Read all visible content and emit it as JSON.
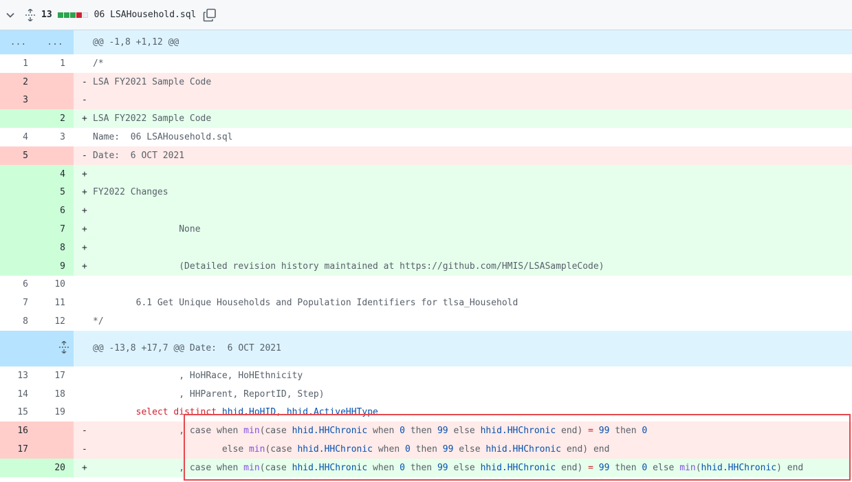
{
  "file_header": {
    "changes_count": "13",
    "filename": "06 LSAHousehold.sql",
    "diffstat": [
      "add",
      "add",
      "add",
      "del",
      "neutral"
    ]
  },
  "hunk1": {
    "old": "...",
    "new": "...",
    "text": "@@ -1,8 +1,12 @@"
  },
  "hunk2": {
    "text": "@@ -13,8 +17,7 @@ Date:  6 OCT 2021"
  },
  "lines1": [
    {
      "type": "ctx",
      "old": "1",
      "new": "1",
      "sign": " ",
      "code": "/*"
    },
    {
      "type": "del",
      "old": "2",
      "new": "",
      "sign": "-",
      "code": "LSA FY2021 Sample Code"
    },
    {
      "type": "del",
      "old": "3",
      "new": "",
      "sign": "-",
      "code": ""
    },
    {
      "type": "add",
      "old": "",
      "new": "2",
      "sign": "+",
      "code": "LSA FY2022 Sample Code"
    },
    {
      "type": "ctx",
      "old": "4",
      "new": "3",
      "sign": " ",
      "code": "Name:  06 LSAHousehold.sql"
    },
    {
      "type": "del",
      "old": "5",
      "new": "",
      "sign": "-",
      "code": "Date:  6 OCT 2021"
    },
    {
      "type": "add",
      "old": "",
      "new": "4",
      "sign": "+",
      "code": ""
    },
    {
      "type": "add",
      "old": "",
      "new": "5",
      "sign": "+",
      "code": "FY2022 Changes"
    },
    {
      "type": "add",
      "old": "",
      "new": "6",
      "sign": "+",
      "code": ""
    },
    {
      "type": "add",
      "old": "",
      "new": "7",
      "sign": "+",
      "code": "                None"
    },
    {
      "type": "add",
      "old": "",
      "new": "8",
      "sign": "+",
      "code": ""
    },
    {
      "type": "add",
      "old": "",
      "new": "9",
      "sign": "+",
      "code": "                (Detailed revision history maintained at https://github.com/HMIS/LSASampleCode)"
    },
    {
      "type": "ctx",
      "old": "6",
      "new": "10",
      "sign": " ",
      "code": ""
    },
    {
      "type": "ctx",
      "old": "7",
      "new": "11",
      "sign": " ",
      "code": "        6.1 Get Unique Households and Population Identifiers for tlsa_Household"
    },
    {
      "type": "ctx",
      "old": "8",
      "new": "12",
      "sign": " ",
      "code": "*/"
    }
  ],
  "lines2": [
    {
      "old": "13",
      "new": "17",
      "type": "ctx",
      "sign": " ",
      "code": "                , HoHRace, HoHEthnicity"
    },
    {
      "old": "14",
      "new": "18",
      "type": "ctx",
      "sign": " ",
      "code": "                , HHParent, ReportID, Step)"
    },
    {
      "old": "15",
      "new": "19",
      "type": "ctx",
      "sign": " "
    },
    {
      "old": "16",
      "new": "",
      "type": "del",
      "sign": "-"
    },
    {
      "old": "17",
      "new": "",
      "type": "del",
      "sign": "-"
    },
    {
      "old": "",
      "new": "20",
      "type": "add",
      "sign": "+"
    }
  ],
  "tokens": {
    "select": "select",
    "distinct": "distinct",
    "hoh": "hhid.HoHID",
    "active": "hhid.ActiveHHType",
    "comma": ",",
    "case": "case",
    "when": "when",
    "then": "then",
    "else": "else",
    "end": "end",
    "min": "min",
    "chronic": "hhid.HHChronic",
    "zero": "0",
    "nn": "99",
    "eq": "=",
    "paren_open": "(",
    "paren_close": ")"
  }
}
